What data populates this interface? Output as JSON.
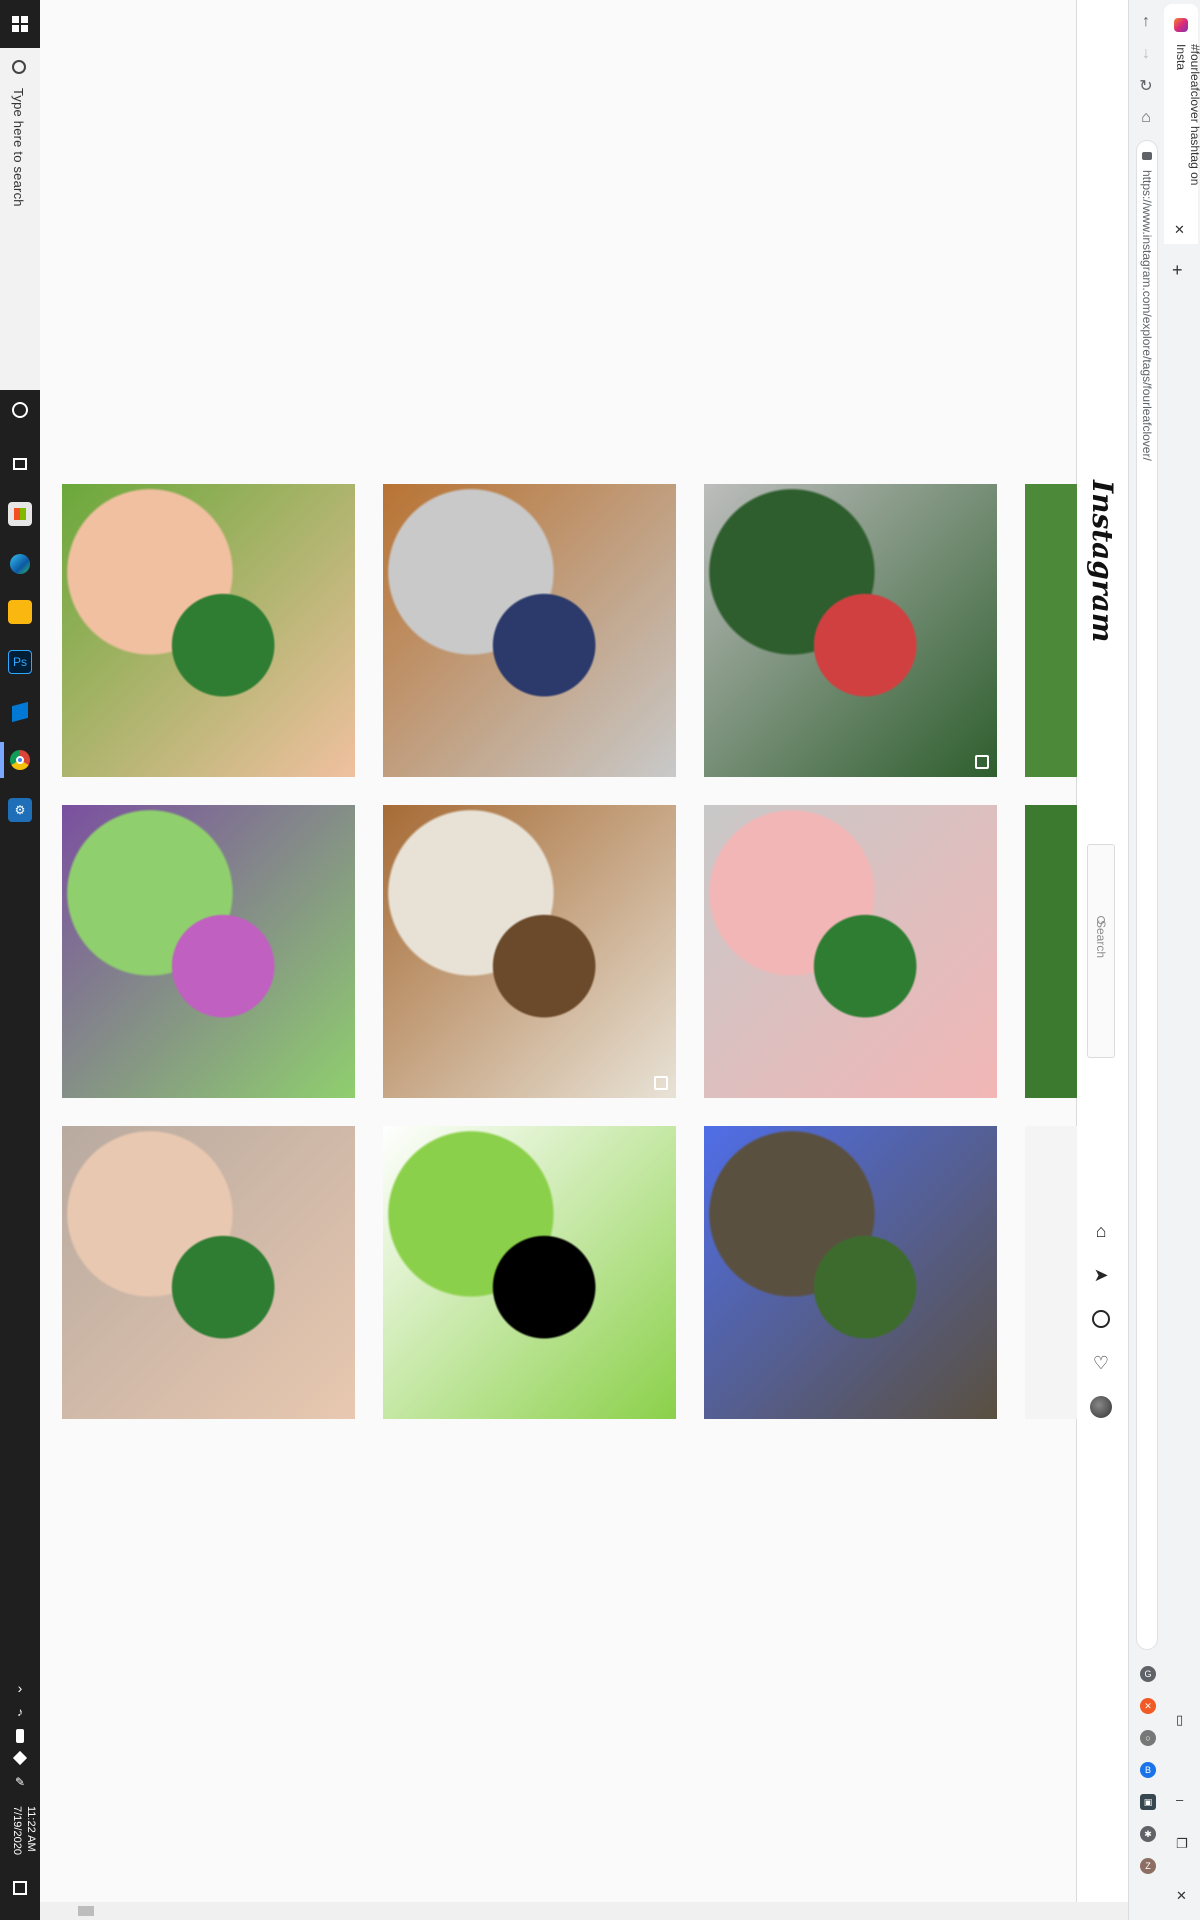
{
  "taskbar": {
    "search_placeholder": "Type here to search",
    "time": "11:22 AM",
    "date": "7/19/2020"
  },
  "browser": {
    "tab_title": "#fourleafclover hashtag on Insta",
    "url": "https://www.instagram.com/explore/tags/fourleafclover/"
  },
  "instagram": {
    "logo": "Instagram",
    "search_placeholder": "Search",
    "avatar_icon": "avatar"
  },
  "posts": [
    {
      "name": "post-hand-four-leaf-clover",
      "colors": [
        "#6aa83a",
        "#f0c0a0",
        "#2e7d32"
      ],
      "multi": false
    },
    {
      "name": "post-balloons-book",
      "colors": [
        "#b87333",
        "#c9c9c9",
        "#2b3a6b"
      ],
      "multi": false
    },
    {
      "name": "post-crochet-flowers",
      "colors": [
        "#bdbdbd",
        "#2e5e2e",
        "#d04040"
      ],
      "multi": true
    },
    {
      "name": "post-hydrangea-clover",
      "colors": [
        "#7a4fa0",
        "#8fcf6e",
        "#c060c0"
      ],
      "multi": false
    },
    {
      "name": "post-vintage-items-collage",
      "colors": [
        "#a66b35",
        "#e8e2d6",
        "#6b4a2b"
      ],
      "multi": true
    },
    {
      "name": "post-clover-crochet-legs",
      "colors": [
        "#c8c8c8",
        "#f2b6b6",
        "#2e7d32"
      ],
      "multi": false
    },
    {
      "name": "post-tattoo-hand-clover",
      "colors": [
        "#b8aaa0",
        "#e8c8b0",
        "#2e7d32"
      ],
      "multi": false
    },
    {
      "name": "post-illustrated-clover",
      "colors": [
        "#ffffff",
        "#8bd04a",
        "#000000"
      ],
      "multi": false
    },
    {
      "name": "post-blue-sign",
      "colors": [
        "#4f6ee8",
        "#5a5040",
        "#3d6b2e"
      ],
      "multi": false
    }
  ],
  "partial_column": [
    "#4c8a3a",
    "#3c7a30",
    "#f4f4f4"
  ]
}
